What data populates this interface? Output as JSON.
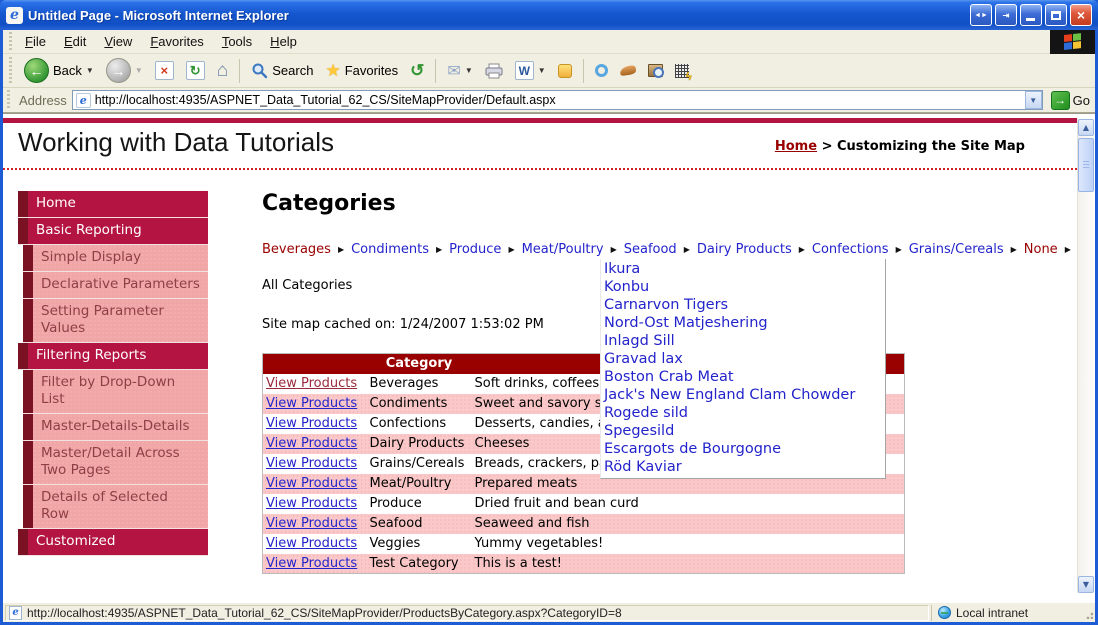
{
  "window": {
    "title": "Untitled Page - Microsoft Internet Explorer"
  },
  "menu_bar": {
    "items": [
      "File",
      "Edit",
      "View",
      "Favorites",
      "Tools",
      "Help"
    ]
  },
  "toolbar": {
    "back_label": "Back",
    "search_label": "Search",
    "favorites_label": "Favorites"
  },
  "address_bar": {
    "label": "Address",
    "url": "http://localhost:4935/ASPNET_Data_Tutorial_62_CS/SiteMapProvider/Default.aspx",
    "go_label": "Go"
  },
  "page": {
    "site_title": "Working with Data Tutorials",
    "breadcrumb": {
      "home": "Home",
      "separator": ">",
      "current": "Customizing the Site Map"
    },
    "sidebar": {
      "items": [
        {
          "label": "Home",
          "level": 1
        },
        {
          "label": "Basic Reporting",
          "level": 1
        },
        {
          "label": "Simple Display",
          "level": 2
        },
        {
          "label": "Declarative Parameters",
          "level": 2
        },
        {
          "label": "Setting Parameter Values",
          "level": 2
        },
        {
          "label": "Filtering Reports",
          "level": 1
        },
        {
          "label": "Filter by Drop-Down List",
          "level": 2
        },
        {
          "label": "Master-Details-Details",
          "level": 2
        },
        {
          "label": "Master/Detail Across Two Pages",
          "level": 2
        },
        {
          "label": "Details of Selected Row",
          "level": 2
        },
        {
          "label": "Customized",
          "level": 1
        }
      ]
    },
    "main": {
      "heading": "Categories",
      "category_menu": {
        "items": [
          {
            "label": "Beverages",
            "link": false
          },
          {
            "label": "Condiments",
            "link": true
          },
          {
            "label": "Produce",
            "link": true
          },
          {
            "label": "Meat/Poultry",
            "link": true
          },
          {
            "label": "Seafood",
            "link": true
          },
          {
            "label": "Dairy Products",
            "link": true
          },
          {
            "label": "Confections",
            "link": true
          },
          {
            "label": "Grains/Cereals",
            "link": true
          },
          {
            "label": "None",
            "link": false
          }
        ]
      },
      "all_categories_label": "All Categories",
      "cache_note": "Site map cached on: 1/24/2007 1:53:02 PM",
      "table": {
        "columns": [
          "",
          "Category",
          ""
        ],
        "link_label": "View Products",
        "rows": [
          {
            "category": "Beverages",
            "description": "Soft drinks, coffees, teas, beers, and ales",
            "visited": true
          },
          {
            "category": "Condiments",
            "description": "Sweet and savory sauces, relishes, spreads, and seasonings",
            "visited": false
          },
          {
            "category": "Confections",
            "description": "Desserts, candies, and sweet breads",
            "visited": false
          },
          {
            "category": "Dairy Products",
            "description": "Cheeses",
            "visited": false
          },
          {
            "category": "Grains/Cereals",
            "description": "Breads, crackers, pasta, and cereal",
            "visited": false
          },
          {
            "category": "Meat/Poultry",
            "description": "Prepared meats",
            "visited": false
          },
          {
            "category": "Produce",
            "description": "Dried fruit and bean curd",
            "visited": false
          },
          {
            "category": "Seafood",
            "description": "Seaweed and fish",
            "visited": false
          },
          {
            "category": "Veggies",
            "description": "Yummy vegetables!",
            "visited": false
          },
          {
            "category": "Test Category",
            "description": "This is a test!",
            "visited": false
          }
        ]
      },
      "seafood_menu": {
        "items": [
          "Ikura",
          "Konbu",
          "Carnarvon Tigers",
          "Nord-Ost Matjeshering",
          "Inlagd Sill",
          "Gravad lax",
          "Boston Crab Meat",
          "Jack's New England Clam Chowder",
          "Rogede sild",
          "Spegesild",
          "Escargots de Bourgogne",
          "Röd Kaviar"
        ]
      }
    }
  },
  "status_bar": {
    "url": "http://localhost:4935/ASPNET_Data_Tutorial_62_CS/SiteMapProvider/ProductsByCategory.aspx?CategoryID=8",
    "zone": "Local intranet"
  },
  "colors": {
    "accent_crimson": "#B41442",
    "accent_dark_maroon": "#7A1224",
    "table_header_maroon": "#990000",
    "sidebar_pink": "#F0A6A6",
    "row_pink": "#FAC8C8",
    "link_blue": "#2323CC",
    "visited_maroon": "#992B3B"
  }
}
